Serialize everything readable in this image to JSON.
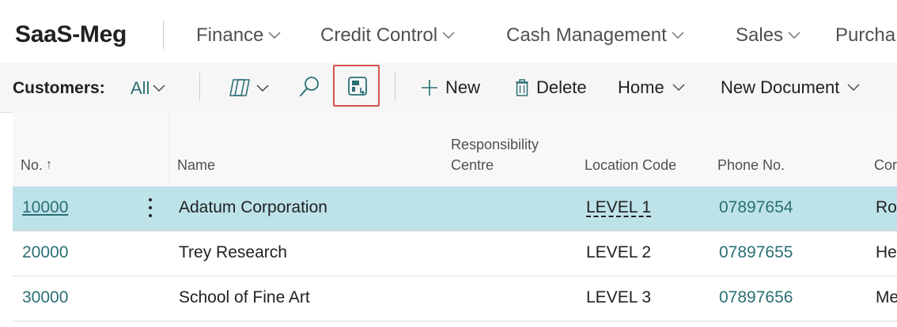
{
  "app": {
    "company": "SaaS-Meg"
  },
  "nav": {
    "items": [
      {
        "label": "Finance"
      },
      {
        "label": "Credit Control"
      },
      {
        "label": "Cash Management"
      },
      {
        "label": "Sales"
      },
      {
        "label": "Purcha"
      }
    ]
  },
  "actionbar": {
    "label": "Customers:",
    "filter": "All",
    "buttons": {
      "new": "New",
      "delete": "Delete",
      "home": "Home",
      "new_document": "New Document"
    },
    "icons": [
      "copilot-icon",
      "search-icon",
      "layout-toggle-icon",
      "plus-icon",
      "trash-icon"
    ]
  },
  "table": {
    "headers": {
      "no": "No.",
      "sort": "↑",
      "name": "Name",
      "responsibility_1": "Responsibility",
      "responsibility_2": "Centre",
      "location": "Location Code",
      "phone": "Phone No.",
      "contact": "Cor"
    },
    "rows": [
      {
        "no": "10000",
        "name": "Adatum Corporation",
        "location": "LEVEL 1",
        "phone": "07897654",
        "contact": "Ro"
      },
      {
        "no": "20000",
        "name": "Trey Research",
        "location": "LEVEL 2",
        "phone": "07897655",
        "contact": "He"
      },
      {
        "no": "30000",
        "name": "School of Fine Art",
        "location": "LEVEL 3",
        "phone": "07897656",
        "contact": "Me"
      }
    ]
  },
  "colors": {
    "accent": "#2a6f74",
    "selected_row": "#bde3e9",
    "highlight": "#d9534f"
  }
}
